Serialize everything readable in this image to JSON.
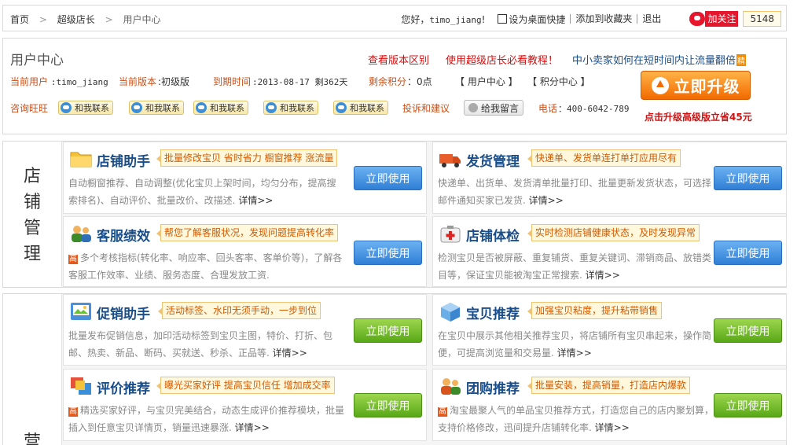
{
  "breadcrumb": {
    "home": "首页",
    "store": "超级店长",
    "current": "用户中心"
  },
  "topbar": {
    "greeting_prefix": "您好，",
    "username": "timo_jiang",
    "greeting_suffix": "!",
    "desktop_shortcut": "设为桌面快捷",
    "add_favorite": "添加到收藏夹",
    "logout": "退出",
    "weibo_follow": "加关注",
    "weibo_count": "5148"
  },
  "user_center": {
    "title": "用户中心",
    "promo_links": [
      "查看版本区别",
      "使用超级店长必看教程！",
      "中小卖家如何在短时间内让流量翻倍"
    ],
    "promo_badge": "精",
    "current_user_label": "当前用户",
    "current_user_value": ":timo_jiang",
    "current_version_label": "当前版本",
    "current_version_value": ":初级版",
    "expiry_label": "到期时间",
    "expiry_value": ":2013-08-17 剩362天",
    "points_label": "剩余积分",
    "points_value": "：0点",
    "link_user_center": "【 用户中心 】",
    "link_points_center": "【 积分中心 】",
    "consult_label": "咨询旺旺",
    "contact_labels": [
      "和我联系",
      "和我联系",
      "和我联系",
      "和我联系",
      "和我联系"
    ],
    "suggest_label": "投诉和建议",
    "leave_message": "给我留言",
    "phone_label": "电话",
    "phone_value": "：400-6042-789",
    "upgrade_button": "立即升级",
    "upgrade_note": "点击升级高级版立省45元"
  },
  "sections": [
    {
      "category": [
        "店",
        "铺",
        "管",
        "理"
      ],
      "cards": [
        {
          "title": "店铺助手",
          "tag": "批量修改宝贝 省时省力 橱窗推荐 涨流量",
          "desc": "自动橱窗推荐、自动调整(优化宝贝上架时间，均匀分布，提高搜索排名)、自动评价、批量改价、改描述.",
          "more": "详情>>",
          "button": "立即使用",
          "icon": "folder-icon"
        },
        {
          "title": "发货管理",
          "tag": "快递单、发货单连打单打应用尽有",
          "desc": "快递单、出货单、发货清单批量打印、批量更新发货状态，可选择邮件通知买家已发货.",
          "more": "详情>>",
          "button": "立即使用",
          "icon": "truck-icon"
        },
        {
          "title": "客服绩效",
          "tag": "帮您了解客服状况，发现问题提高转化率",
          "badge": "高",
          "desc": "多个考核指标(转化率、响应率、回头客率、客单价等)，了解各客服工作效率、业绩、服务态度、合理发放工资.",
          "more": "",
          "button": "立即使用",
          "icon": "people-icon"
        },
        {
          "title": "店铺体检",
          "tag": "实时检测店铺健康状态，及时发现异常",
          "desc": "检测宝贝是否被屏蔽、重复铺货、重复关键词、滞销商品、放错类目等，保证宝贝能被淘宝正常搜索.",
          "more": "详情>>",
          "button": "立即使用",
          "icon": "medkit-icon"
        }
      ]
    },
    {
      "category": [
        "营"
      ],
      "cards": [
        {
          "title": "促销助手",
          "tag": "活动标签、水印无须手动，一步到位",
          "desc": "批量发布促销信息，加印活动标签到宝贝主图，特价、打折、包邮、热卖、新品、断码、买就送、秒杀、正品等.",
          "more": "详情>>",
          "button": "立即使用",
          "icon": "promo-icon"
        },
        {
          "title": "宝贝推荐",
          "tag": "加强宝贝粘度，提升粘带销售",
          "desc": "在宝贝中展示其他相关推荐宝贝，将店铺所有宝贝串起来，操作简便，可提高浏览量和交易量.",
          "more": "详情>>",
          "button": "立即使用",
          "icon": "box-icon"
        },
        {
          "title": "评价推荐",
          "tag": "曝光买家好评 提高宝贝信任 增加成交率",
          "badge": "高",
          "desc": "精选买家好评，与宝贝完美结合，动态生成评价推荐模块，批量插入到任意宝贝详情页，销量迅速暴涨.",
          "more": "详情>>",
          "button": "立即使用",
          "icon": "review-icon"
        },
        {
          "title": "团购推荐",
          "tag": "批量安装，提高销量，打造店内爆款",
          "badge": "高",
          "desc": "淘宝最聚人气的单品宝贝推荐方式，打造您自己的店内聚划算，支持价格修改，迅间提升店铺转化率.",
          "more": "详情>>",
          "button": "立即使用",
          "icon": "group-icon"
        }
      ]
    }
  ],
  "colors": {
    "accent_orange": "#c8501a",
    "title_blue": "#1a4e8a",
    "promo_red": "#d21010",
    "btn_blue": "#2f7fd6",
    "btn_green": "#58a817"
  }
}
